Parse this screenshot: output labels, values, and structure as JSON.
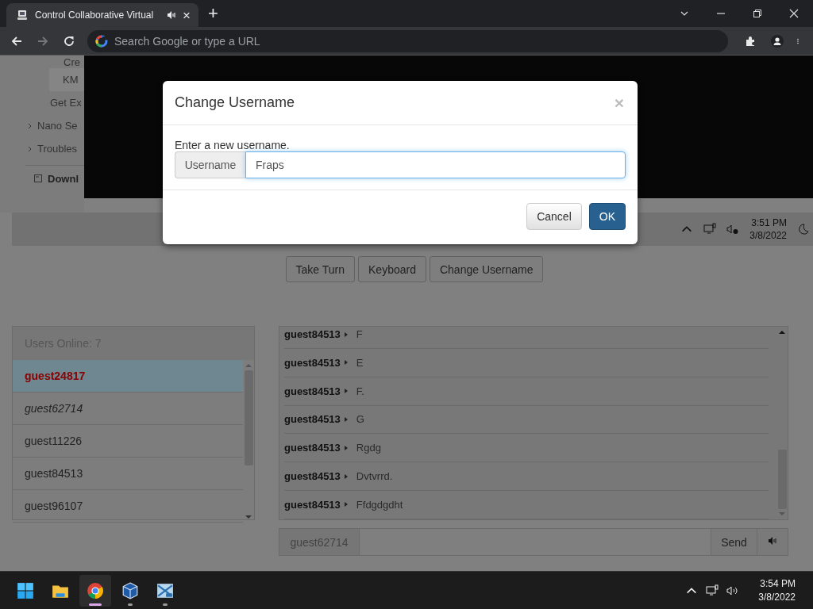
{
  "browser": {
    "tab": {
      "title": "Control Collaborative Virtual",
      "close": "×"
    },
    "new_tab": "+",
    "address_bar": {
      "placeholder": "Search Google or type a URL"
    }
  },
  "sidebar": {
    "items": [
      {
        "label": "Cre",
        "kind": "sub",
        "selected": false
      },
      {
        "label": "KM",
        "kind": "sub",
        "selected": true
      },
      {
        "label": "Get Ex",
        "kind": "link",
        "selected": false
      },
      {
        "label": "Nano Se",
        "kind": "group",
        "selected": false
      },
      {
        "label": "Troubles",
        "kind": "group",
        "selected": false
      },
      {
        "label": "Downl",
        "kind": "download",
        "selected": false
      }
    ]
  },
  "vm_screen": {
    "tray": {
      "time": "3:51 PM",
      "date": "3/8/2022"
    }
  },
  "controls": [
    {
      "label": "Take Turn"
    },
    {
      "label": "Keyboard"
    },
    {
      "label": "Change Username"
    }
  ],
  "users": {
    "header": "Users Online: 7",
    "items": [
      {
        "name": "guest24817",
        "kind": "turn",
        "selected": true
      },
      {
        "name": "guest62714",
        "kind": "self",
        "selected": false
      },
      {
        "name": "guest11226",
        "kind": "other",
        "selected": false
      },
      {
        "name": "guest84513",
        "kind": "other",
        "selected": false
      },
      {
        "name": "guest96107",
        "kind": "other",
        "selected": false
      }
    ]
  },
  "chat": {
    "messages": [
      {
        "user": "guest84513",
        "text": "F"
      },
      {
        "user": "guest84513",
        "text": "E"
      },
      {
        "user": "guest84513",
        "text": "F."
      },
      {
        "user": "guest84513",
        "text": "G"
      },
      {
        "user": "guest84513",
        "text": "Rgdg"
      },
      {
        "user": "guest84513",
        "text": "Dvtvrrd."
      },
      {
        "user": "guest84513",
        "text": "Ffdgdgdht"
      }
    ],
    "input": {
      "name": "guest62714",
      "send": "Send"
    }
  },
  "dialog": {
    "title": "Change Username",
    "close": "×",
    "prompt": "Enter a new username.",
    "field": {
      "label": "Username",
      "value": "Fraps"
    },
    "buttons": [
      {
        "label": "Cancel",
        "kind": "default"
      },
      {
        "label": "OK",
        "kind": "primary"
      }
    ]
  },
  "taskbar": {
    "apps": [
      {
        "kind": "start",
        "open": false,
        "selected": false
      },
      {
        "kind": "folder",
        "open": false,
        "selected": false
      },
      {
        "kind": "browser",
        "open": true,
        "selected": true
      },
      {
        "kind": "cube",
        "open": true,
        "selected": false
      },
      {
        "kind": "vm",
        "open": true,
        "selected": false
      }
    ],
    "time": "3:54 PM",
    "date": "3/8/2022"
  }
}
